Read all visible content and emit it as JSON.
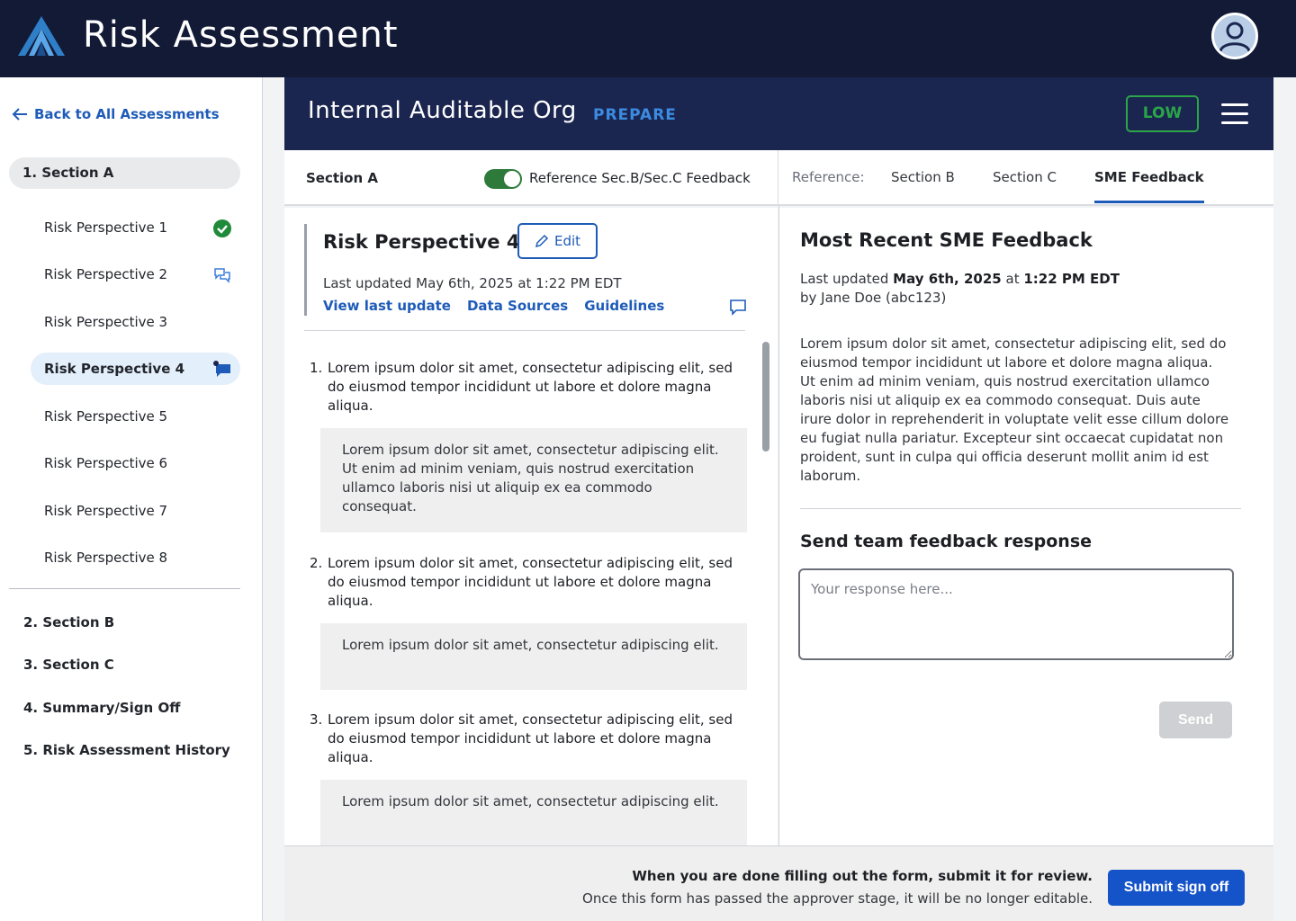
{
  "app": {
    "title": "Risk Assessment"
  },
  "sidebar": {
    "back_label": "Back to All Assessments",
    "section_a": "1. Section A",
    "perspectives": [
      {
        "label": "Risk Perspective 1",
        "icon": "check-circle-icon"
      },
      {
        "label": "Risk Perspective 2",
        "icon": "chat-bubbles-icon"
      },
      {
        "label": "Risk Perspective 3",
        "icon": ""
      },
      {
        "label": "Risk Perspective 4",
        "icon": "chat-flag-icon",
        "active": true
      },
      {
        "label": "Risk Perspective 5",
        "icon": ""
      },
      {
        "label": "Risk Perspective 6",
        "icon": ""
      },
      {
        "label": "Risk Perspective 7",
        "icon": ""
      },
      {
        "label": "Risk Perspective 8",
        "icon": ""
      }
    ],
    "sections": [
      "2. Section  B",
      "3. Section C",
      "4. Summary/Sign Off",
      "5. Risk Assessment History"
    ]
  },
  "header": {
    "org_name": "Internal Auditable Org",
    "phase": "PREPARE",
    "risk_level": "LOW"
  },
  "subbar": {
    "section_title": "Section A",
    "toggle_label": "Reference Sec.B/Sec.C Feedback",
    "toggle_on": true,
    "reference_label": "Reference:",
    "tabs": [
      "Section B",
      "Section C",
      "SME Feedback"
    ],
    "active_tab": "SME Feedback"
  },
  "perspective": {
    "title": "Risk Perspective 4",
    "edit_label": "Edit",
    "last_updated": "Last updated May 6th, 2025 at 1:22 PM EDT",
    "links": [
      "View last update",
      "Data Sources",
      "Guidelines"
    ],
    "questions": [
      {
        "num": "1.",
        "text": "Lorem ipsum dolor sit amet, consectetur adipiscing elit, sed do eiusmod tempor incididunt ut labore et dolore magna aliqua.",
        "answer": "Lorem ipsum dolor sit amet, consectetur adipiscing elit. Ut enim ad minim veniam, quis nostrud exercitation ullamco laboris nisi ut aliquip ex ea commodo consequat."
      },
      {
        "num": "2.",
        "text": "Lorem ipsum dolor sit amet, consectetur adipiscing elit, sed do eiusmod tempor incididunt ut labore et dolore magna aliqua.",
        "answer": "Lorem ipsum dolor sit amet, consectetur adipiscing elit."
      },
      {
        "num": "3.",
        "text": "Lorem ipsum dolor sit amet, consectetur adipiscing elit, sed do eiusmod tempor incididunt ut labore et dolore magna aliqua.",
        "answer": "Lorem ipsum dolor sit amet, consectetur adipiscing elit."
      }
    ]
  },
  "feedback": {
    "title": "Most Recent SME Feedback",
    "last_updated_prefix": "Last updated",
    "last_updated_date": "May 6th, 2025",
    "last_updated_at": "at",
    "last_updated_time": "1:22 PM EDT",
    "author": "by Jane Doe (abc123)",
    "body": "Lorem ipsum dolor sit amet, consectetur adipiscing elit, sed do eiusmod tempor incididunt ut labore et dolore magna aliqua. Ut enim ad minim veniam, quis nostrud exercitation ullamco laboris nisi ut aliquip ex ea commodo consequat. Duis aute irure dolor in reprehenderit in voluptate velit esse cillum dolore eu fugiat nulla pariatur. Excepteur sint occaecat cupidatat non proident, sunt in culpa qui officia deserunt mollit anim id est laborum.",
    "response_heading": "Send team feedback response",
    "response_placeholder": "Your response here...",
    "send_label": "Send"
  },
  "footer": {
    "line1": "When you are done filling out the form, submit it for review.",
    "line2": "Once this form has passed the approver stage, it will be no longer editable.",
    "submit_label": "Submit sign off"
  },
  "colors": {
    "navy": "#121a36",
    "panel_navy": "#1b2650",
    "accent_blue": "#1e5bb8",
    "low_green": "#2aa548"
  }
}
